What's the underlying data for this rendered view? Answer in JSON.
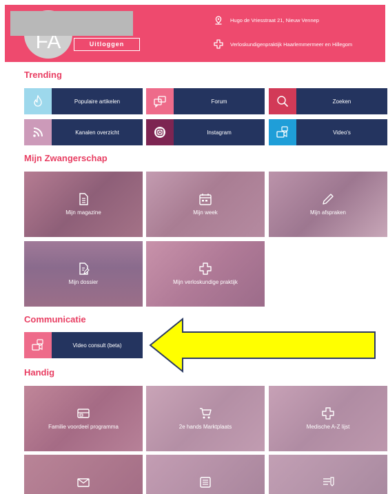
{
  "header": {
    "avatar_initials": "FA",
    "logout_label": "Uitloggen",
    "address": "Hugo de Vriesstraat 21, Nieuw Vennep",
    "practice": "Verloskundigenpraktijk Haarlemmermeer en Hillegom"
  },
  "sections": {
    "trending": "Trending",
    "pregnancy": "Mijn Zwangerschap",
    "communication": "Communicatie",
    "handy": "Handig"
  },
  "trending_items": [
    {
      "label": "Populaire artikelen",
      "icon": "flame-icon",
      "color": "#9dd8ec"
    },
    {
      "label": "Forum",
      "icon": "chat-bubbles-icon",
      "color": "#ee6b8a"
    },
    {
      "label": "Zoeken",
      "icon": "search-icon",
      "color": "#d23a57"
    },
    {
      "label": "Kanalen overzicht",
      "icon": "rss-icon",
      "color": "#cc9ab9"
    },
    {
      "label": "Instagram",
      "icon": "instagram-icon",
      "color": "#7d2552"
    },
    {
      "label": "Video's",
      "icon": "video-chat-icon",
      "color": "#1f9ed8"
    }
  ],
  "pregnancy_tiles": [
    {
      "label": "Mijn magazine",
      "icon": "document-icon"
    },
    {
      "label": "Mijn week",
      "icon": "calendar-icon"
    },
    {
      "label": "Mijn afspraken",
      "icon": "pencil-icon"
    },
    {
      "label": "Mijn dossier",
      "icon": "edit-document-icon"
    },
    {
      "label": "Mijn verloskundige praktijk",
      "icon": "medical-cross-icon"
    }
  ],
  "communication_item": {
    "label": "Video consult (beta)",
    "icon": "video-chat-icon",
    "color": "#ee6b8a"
  },
  "handy_tiles": [
    {
      "label": "Familie voordeel programma",
      "icon": "gift-card-icon"
    },
    {
      "label": "2e hands Marktplaats",
      "icon": "cart-icon"
    },
    {
      "label": "Medische A-Z lijst",
      "icon": "medical-cross-icon"
    },
    {
      "label": "",
      "icon": "envelope-icon"
    },
    {
      "label": "",
      "icon": "list-icon"
    },
    {
      "label": "",
      "icon": "checklist-icon"
    }
  ],
  "colors": {
    "brand_pink": "#ee4a6e",
    "navy": "#24345f",
    "title_pink": "#e83e62",
    "arrow_yellow": "#ffff00"
  }
}
